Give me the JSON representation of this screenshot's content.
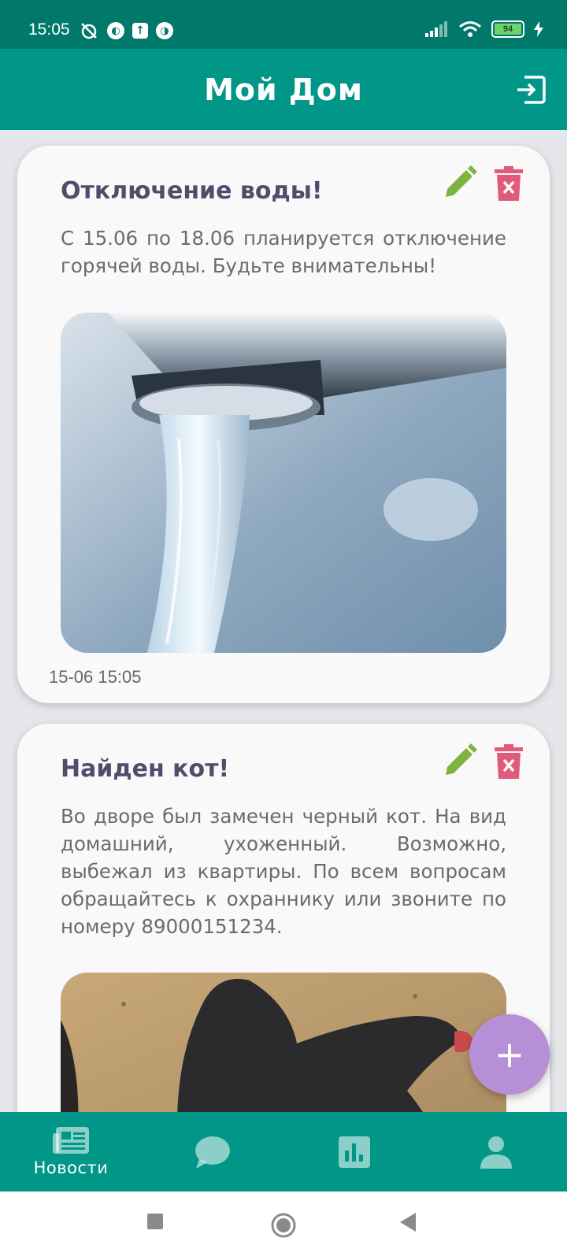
{
  "status_bar": {
    "time": "15:05",
    "battery": "94"
  },
  "app_bar": {
    "title": "Мой Дом",
    "logout_icon": "logout-icon"
  },
  "posts": [
    {
      "title": "Отключение воды!",
      "body": "С 15.06 по 18.06 планируется отключение горячей воды. Будьте внимательны!",
      "image": "water-faucet-photo",
      "date": "15-06 15:05"
    },
    {
      "title": "Найден кот!",
      "body": "Во дворе был замечен черный кот. На вид домашний, ухоженный. Возможно, выбежал из квартиры. По всем вопросам обращайтесь к охраннику или звоните по номеру 89000151234.",
      "image": "black-cat-photo"
    }
  ],
  "fab": {
    "label": "+"
  },
  "bottom_nav": [
    {
      "label": "Новости",
      "icon": "newspaper-icon",
      "active": true
    },
    {
      "label": "",
      "icon": "chat-icon",
      "active": false
    },
    {
      "label": "",
      "icon": "chart-icon",
      "active": false
    },
    {
      "label": "",
      "icon": "profile-icon",
      "active": false
    }
  ],
  "colors": {
    "primary": "#009688",
    "status_bar": "#00796b",
    "edit": "#7cb342",
    "delete": "#e25a7a",
    "fab": "#b78fd6",
    "title_text": "#4f4d6b"
  }
}
